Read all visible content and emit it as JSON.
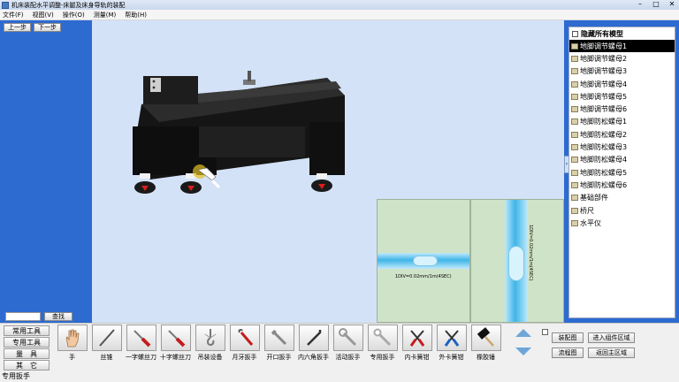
{
  "window": {
    "title": "机床装配水平调整-床腿及床身导轨的装配",
    "controls": [
      "–",
      "□",
      "✕"
    ]
  },
  "menu": [
    "文件(F)",
    "视图(V)",
    "操作(O)",
    "测量(M)",
    "帮助(H)"
  ],
  "viewport_buttons": [
    "上一步",
    "下一步"
  ],
  "model_panel": {
    "header": "隐藏所有模型",
    "items": [
      "地脚调节螺母1",
      "地脚调节螺母2",
      "地脚调节螺母3",
      "地脚调节螺母4",
      "地脚调节螺母5",
      "地脚调节螺母6",
      "地脚防松螺母1",
      "地脚防松螺母2",
      "地脚防松螺母3",
      "地脚防松螺母4",
      "地脚防松螺母5",
      "地脚防松螺母6",
      "基础部件",
      "桥尺",
      "水平仪"
    ]
  },
  "gauges": {
    "horizontal_caption": "1DIV=0.02mm/1m(4SEC)",
    "vertical_caption": "1DIV=0.02mm/1m(4SEC)"
  },
  "bottom": {
    "search_button": "查找",
    "categories": [
      "常用工具",
      "专用工具",
      "量　具",
      "其　它"
    ],
    "tools": [
      "手",
      "丝锥",
      "一字螺丝刀",
      "十字螺丝刀",
      "吊装设备",
      "月牙扳手",
      "开口扳手",
      "内六角扳手",
      "活动扳手",
      "专用扳手",
      "内卡簧钳",
      "外卡簧钳",
      "橡胶锤"
    ],
    "action_buttons": {
      "assembly_diagram": "装配图",
      "flow_chart": "流程图",
      "enter_component": "进入组件区域",
      "return_main": "返回主区域"
    },
    "status": "专用扳手"
  }
}
